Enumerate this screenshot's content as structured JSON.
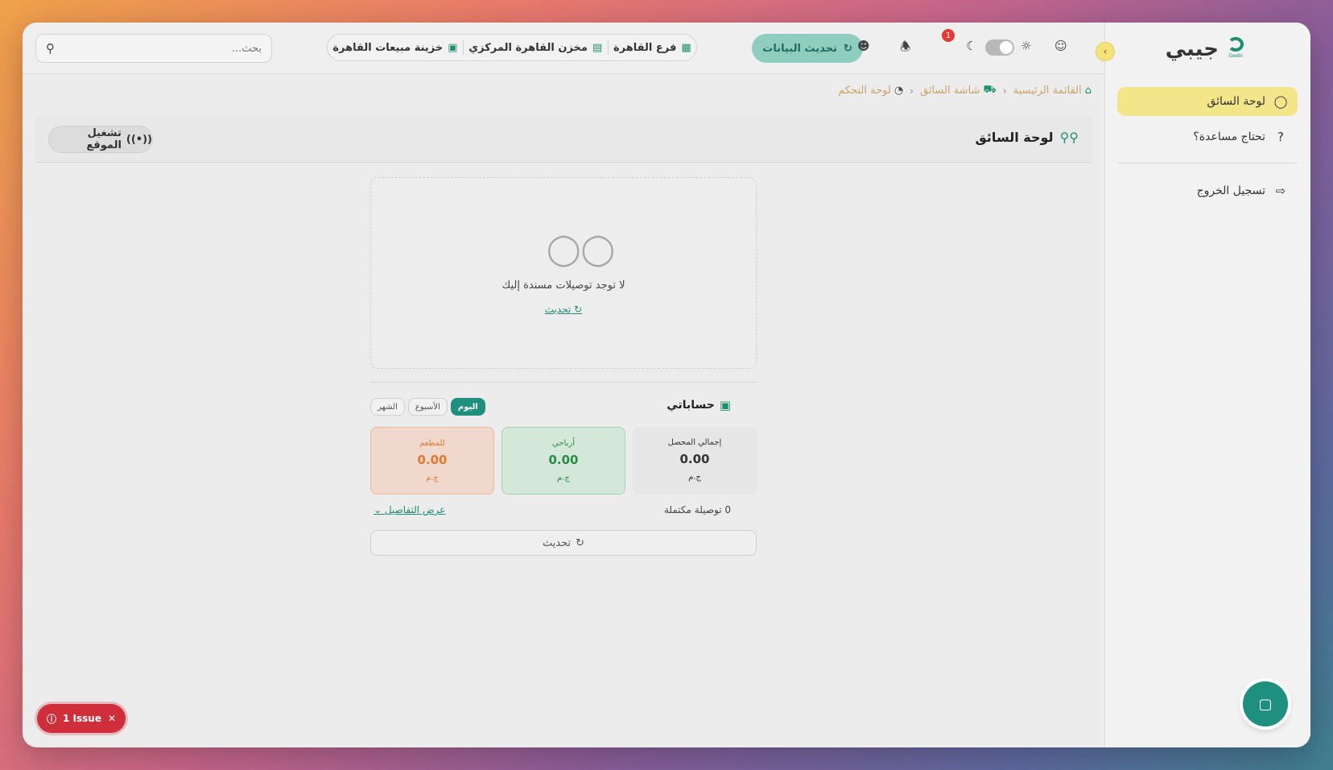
{
  "app": {
    "logo_text": "جيبي",
    "logo_sub": "Geebi"
  },
  "sidebar": {
    "items": [
      {
        "label": "لوحة السائق",
        "icon": "bicycle-icon",
        "active": true
      },
      {
        "label": "تحتاج مساعدة؟",
        "icon": "help-circle-icon",
        "active": false
      }
    ],
    "logout": {
      "label": "تسجيل الخروج",
      "icon": "logout-icon"
    }
  },
  "topbar": {
    "search": {
      "placeholder": "بحث..."
    },
    "branches": [
      {
        "label": "فرع القاهرة",
        "icon": "building-icon"
      },
      {
        "label": "مخزن القاهرة المركزي",
        "icon": "warehouse-icon"
      },
      {
        "label": "خزينة مبيعات القاهرة",
        "icon": "wallet-icon"
      }
    ],
    "refresh_data_label": "تحديث البيانات",
    "notifications_count": "1"
  },
  "breadcrumb": [
    {
      "label": "القائمة الرئيسية",
      "icon": "home-icon"
    },
    {
      "label": "شاشة السائق",
      "icon": "car-icon"
    },
    {
      "label": "لوحة التحكم",
      "icon": "gauge-icon"
    }
  ],
  "page": {
    "title": "لوحة السائق",
    "location_button": "تشغيل الموقع"
  },
  "deliveries": {
    "empty_text": "لا توجد توصيلات مسندة إليك",
    "refresh_label": "تحديث"
  },
  "accounts": {
    "title": "حساباتي",
    "tabs": [
      "اليوم",
      "الأسبوع",
      "الشهر"
    ],
    "active_tab": "اليوم",
    "stats": [
      {
        "label": "إجمالي المحصل",
        "value": "0.00",
        "currency": "ج.م"
      },
      {
        "label": "أرباحي",
        "value": "0.00",
        "currency": "ج.م"
      },
      {
        "label": "للمطعم",
        "value": "0.00",
        "currency": "ج.م"
      }
    ],
    "completed": "0 توصيلة مكتملة",
    "details_link": "عرض التفاصيل",
    "refresh_label": "تحديث"
  },
  "issues": {
    "label": "1 Issue"
  },
  "colors": {
    "accent": "#1f8f80",
    "active_nav": "#f3e58a",
    "danger": "#cf2f3a"
  }
}
